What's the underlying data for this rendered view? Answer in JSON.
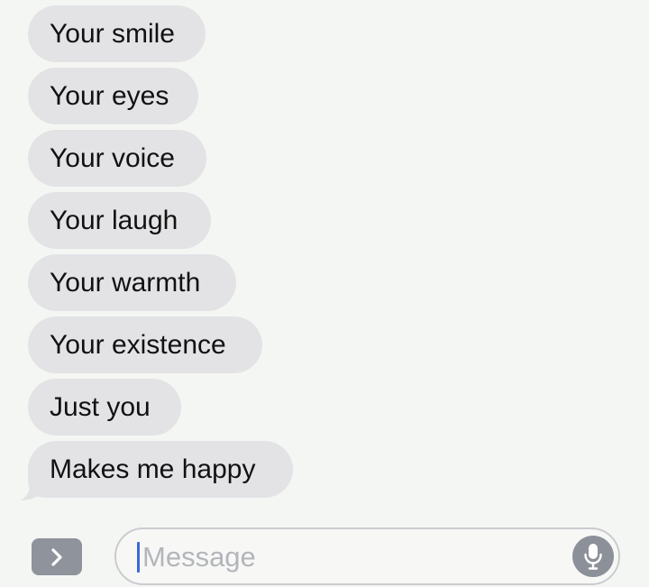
{
  "conversation": {
    "messages": [
      {
        "text": "Your smile"
      },
      {
        "text": "Your eyes"
      },
      {
        "text": "Your voice"
      },
      {
        "text": "Your laugh"
      },
      {
        "text": "Your warmth"
      },
      {
        "text": "Your existence"
      },
      {
        "text": "Just you"
      },
      {
        "text": "Makes me happy"
      }
    ]
  },
  "composer": {
    "placeholder": "Message",
    "expand_icon": "chevron-right-icon",
    "mic_icon": "microphone-icon"
  },
  "colors": {
    "background": "#f4f6f3",
    "incoming_bubble": "#e3e3e6",
    "caret": "#3e66d8",
    "button_gray": "#8f939c"
  }
}
